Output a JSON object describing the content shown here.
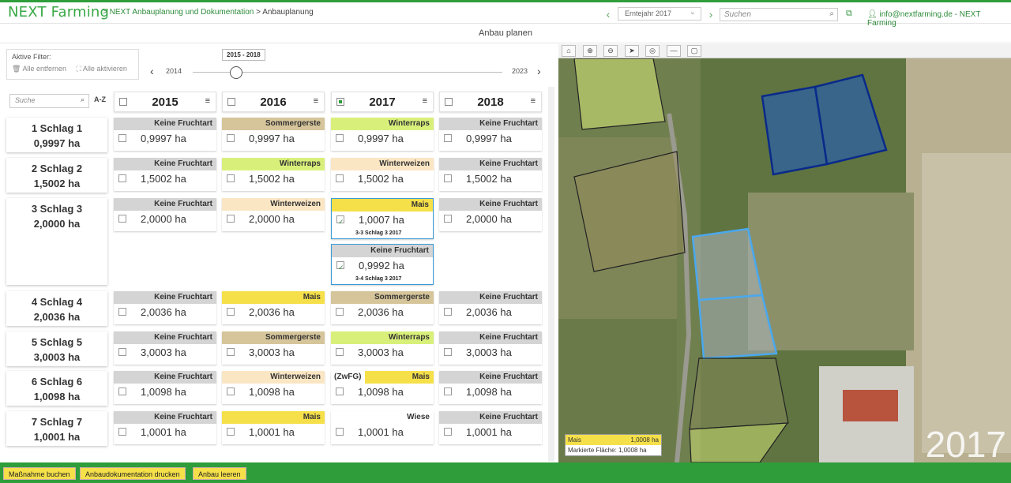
{
  "app": {
    "logo": "NEXT Farming",
    "breadcrumb_link": "> NEXT Anbauplanung und Dokumentation",
    "breadcrumb_sep": ">",
    "breadcrumb_current": "Anbauplanung"
  },
  "header": {
    "year_select": "Erntejahr 2017",
    "search_placeholder": "Suchen",
    "user": "info@nextfarming.de - NEXT Farming"
  },
  "page": {
    "title": "Anbau planen"
  },
  "filter": {
    "title": "Aktive Filter:",
    "remove_all": "Alle entfernen",
    "activate_all": "Alle aktivieren"
  },
  "timeline": {
    "range": "2015 - 2018",
    "start": "2014",
    "end": "2023",
    "position": 0.14
  },
  "plotlist": {
    "search_placeholder": "Suche",
    "sort_label": "A-Z"
  },
  "years": [
    {
      "label": "2015",
      "checked": false
    },
    {
      "label": "2016",
      "checked": false
    },
    {
      "label": "2017",
      "checked": true
    },
    {
      "label": "2018",
      "checked": false
    }
  ],
  "plots": [
    {
      "name": "1 Schlag 1",
      "area": "0,9997 ha",
      "cells": [
        {
          "crop": "Keine Fruchtart",
          "area": "0,9997 ha"
        },
        {
          "crop": "Sommergerste",
          "area": "0,9997 ha"
        },
        {
          "crop": "Winterraps",
          "area": "0,9997 ha"
        },
        {
          "crop": "Keine Fruchtart",
          "area": "0,9997 ha"
        }
      ]
    },
    {
      "name": "2 Schlag 2",
      "area": "1,5002 ha",
      "cells": [
        {
          "crop": "Keine Fruchtart",
          "area": "1,5002 ha"
        },
        {
          "crop": "Winterraps",
          "area": "1,5002 ha"
        },
        {
          "crop": "Winterweizen",
          "area": "1,5002 ha"
        },
        {
          "crop": "Keine Fruchtart",
          "area": "1,5002 ha"
        }
      ]
    },
    {
      "name": "3 Schlag 3",
      "area": "2,0000 ha",
      "cells": [
        {
          "crop": "Keine Fruchtart",
          "area": "2,0000 ha"
        },
        {
          "crop": "Winterweizen",
          "area": "2,0000 ha"
        },
        {
          "crop": "Mais",
          "area": "1,0007 ha",
          "ref": "3-3 Schlag 3 2017"
        },
        {
          "crop": "Keine Fruchtart",
          "area": "2,0000 ha"
        }
      ],
      "extra": {
        "crop": "Keine Fruchtart",
        "area": "0,9992 ha",
        "ref": "3-4 Schlag 3 2017"
      }
    },
    {
      "name": "4 Schlag 4",
      "area": "2,0036 ha",
      "cells": [
        {
          "crop": "Keine Fruchtart",
          "area": "2,0036 ha"
        },
        {
          "crop": "Mais",
          "area": "2,0036 ha"
        },
        {
          "crop": "Sommergerste",
          "area": "2,0036 ha"
        },
        {
          "crop": "Keine Fruchtart",
          "area": "2,0036 ha"
        }
      ]
    },
    {
      "name": "5 Schlag 5",
      "area": "3,0003 ha",
      "cells": [
        {
          "crop": "Keine Fruchtart",
          "area": "3,0003 ha"
        },
        {
          "crop": "Sommergerste",
          "area": "3,0003 ha"
        },
        {
          "crop": "Winterraps",
          "area": "3,0003 ha"
        },
        {
          "crop": "Keine Fruchtart",
          "area": "3,0003 ha"
        }
      ]
    },
    {
      "name": "6 Schlag 6",
      "area": "1,0098 ha",
      "cells": [
        {
          "crop": "Keine Fruchtart",
          "area": "1,0098 ha"
        },
        {
          "crop": "Winterweizen",
          "area": "1,0098 ha"
        },
        {
          "crop": "Mais",
          "area": "1,0098 ha",
          "zw": "(ZwFG)"
        },
        {
          "crop": "Keine Fruchtart",
          "area": "1,0098 ha"
        }
      ]
    },
    {
      "name": "7 Schlag 7",
      "area": "1,0001 ha",
      "cells": [
        {
          "crop": "Keine Fruchtart",
          "area": "1,0001 ha"
        },
        {
          "crop": "Mais",
          "area": "1,0001 ha"
        },
        {
          "crop": "Wiese",
          "area": "1,0001 ha"
        },
        {
          "crop": "Keine Fruchtart",
          "area": "1,0001 ha"
        }
      ]
    }
  ],
  "crop_colors": {
    "Keine Fruchtart": "#d4d4d4",
    "Sommergerste": "#d6c59a",
    "Winterraps": "#d8f07a",
    "Winterweizen": "#fbe6c4",
    "Mais": "#f5e04a",
    "Wiese": "#ffffff"
  },
  "map": {
    "legend_crop": "Mais",
    "legend_area": "1,0008 ha",
    "marked_area": "Markierte Fläche: 1,0008 ha",
    "year": "2017"
  },
  "footer": {
    "btn1": "Maßnahme buchen",
    "btn2": "Anbaudokumentation drucken",
    "btn3": "Anbau leeren"
  },
  "colors": {
    "brand": "#2e9d3a",
    "button": "#f5e04a",
    "select_blue": "#3a9bd8"
  }
}
